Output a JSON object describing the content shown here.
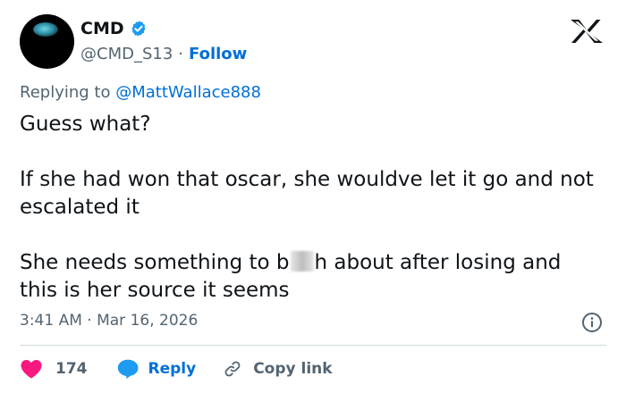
{
  "tweet": {
    "display_name": "CMD",
    "handle": "@CMD_S13",
    "separator": "·",
    "follow_label": "Follow",
    "replying_prefix": "Replying to",
    "replying_mention": "@MattWallace888",
    "body": {
      "line1": "Guess what?",
      "para2": "If she had won that oscar, she wouldve let it go and not escalated it",
      "para3_before": "She needs something to b",
      "para3_after": "h about after losing and this is her source it seems"
    },
    "timestamp": "3:41 AM · Mar 16, 2026"
  },
  "actions": {
    "like_count": "174",
    "reply_label": "Reply",
    "copy_link_label": "Copy link"
  },
  "icons": {
    "verified": "verified-badge-icon",
    "x_logo": "x-logo-icon",
    "info": "info-icon",
    "like": "heart-icon",
    "reply": "speech-bubble-icon",
    "copy": "link-icon"
  },
  "colors": {
    "link_blue": "#006fd6",
    "verified_blue": "#1d9bf0",
    "like_red": "#f91880",
    "muted_text": "#536471",
    "text": "#0f1419",
    "divider": "#cfd9de"
  }
}
